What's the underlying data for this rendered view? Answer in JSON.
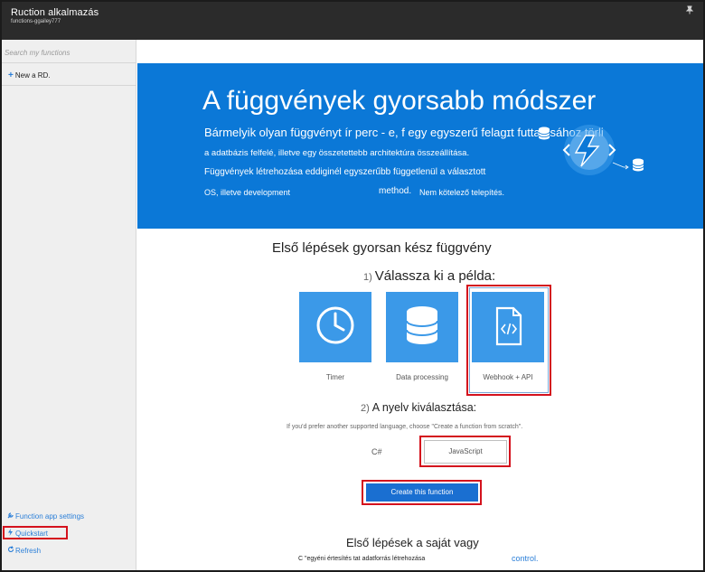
{
  "window": {
    "title": "Ruction alkalmazás",
    "subtitle": "functions-ggailey777",
    "pin_icon": "pin-icon"
  },
  "sidebar": {
    "search_placeholder": "Search my functions",
    "new_label": "New a RD.",
    "links": {
      "settings": "Function app settings",
      "quickstart": "Quickstart",
      "refresh": "Refresh"
    }
  },
  "hero": {
    "title": "A függvények gyorsabb módszer",
    "line1": "Bármelyik olyan függvényt ír perc - e, f egy egyszerű felaɡɪt futtatásához törli",
    "line2": "a adatbázis felfelé, illetve egy összetettebb architektúra összeállítása.",
    "line3": "Függvények létrehozása eddiginél egyszerűbb függetlenül a választott",
    "line4a": "OS, illetve development",
    "line4b": "method.",
    "line4c": "Nem kötelező telepítés."
  },
  "quickstart": {
    "heading": "Első lépések gyorsan kész függvény",
    "step1_number": "1)",
    "step1_label": "Válassza ki a példa:",
    "tiles": [
      {
        "label": "Timer",
        "icon": "clock-icon"
      },
      {
        "label": "Data processing",
        "icon": "database-icon"
      },
      {
        "label": "Webhook + API",
        "icon": "code-file-icon"
      }
    ],
    "step2_number": "2)",
    "step2_label": "A nyelv kiválasztása:",
    "hint": "If you'd prefer another supported language, choose \"Create a function from scratch\".",
    "languages": [
      "C#",
      "JavaScript"
    ],
    "selected_language": "JavaScript",
    "create_button": "Create this function"
  },
  "own": {
    "heading": "Első lépések a saját vagy",
    "line": "C \"egyéni  értesítés tat adatforrás létrehozása",
    "link": "control."
  },
  "colors": {
    "titlebar": "#2b2b2b",
    "hero": "#0b78d7",
    "tile": "#3b99e8",
    "highlight": "#d4121d",
    "link": "#2b7fd8",
    "button": "#1a6fd1"
  }
}
